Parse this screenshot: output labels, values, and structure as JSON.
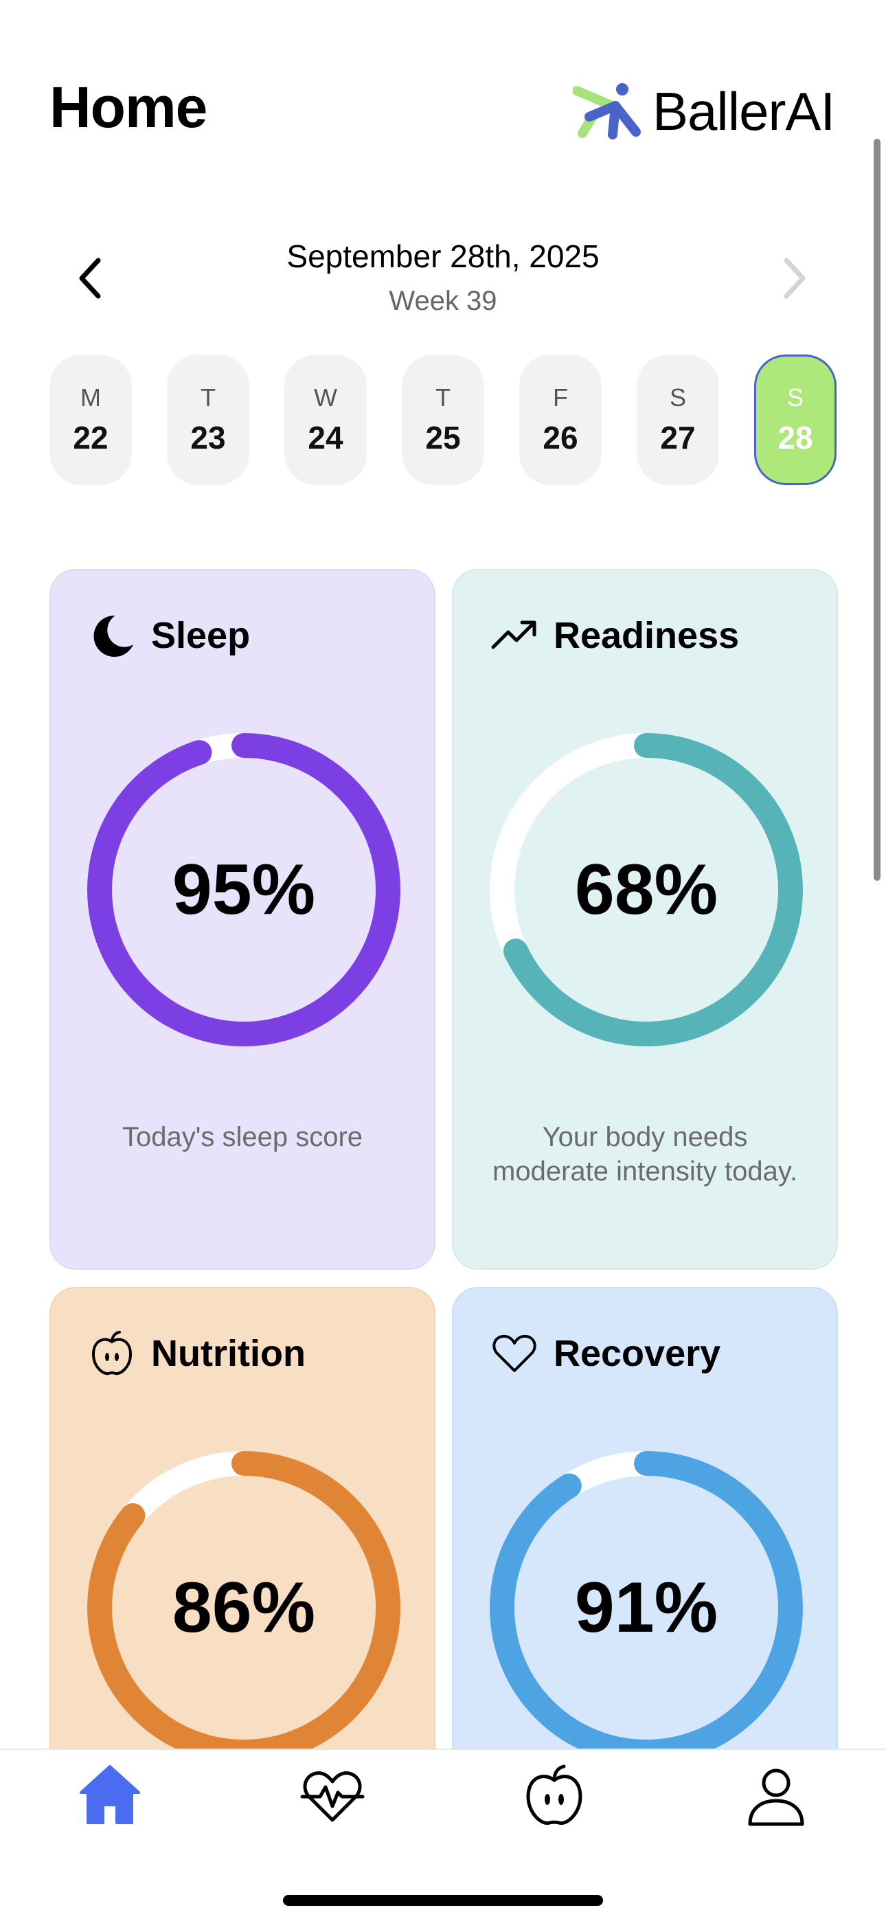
{
  "header": {
    "title": "Home",
    "logo_text": "BallerAI"
  },
  "date_nav": {
    "date": "September 28th, 2025",
    "week": "Week 39"
  },
  "days": [
    {
      "letter": "M",
      "num": "22"
    },
    {
      "letter": "T",
      "num": "23"
    },
    {
      "letter": "W",
      "num": "24"
    },
    {
      "letter": "T",
      "num": "25"
    },
    {
      "letter": "F",
      "num": "26"
    },
    {
      "letter": "S",
      "num": "27"
    },
    {
      "letter": "S",
      "num": "28"
    }
  ],
  "selected_day_index": 6,
  "cards": [
    {
      "title": "Sleep",
      "value": "95%",
      "fraction": 0.95,
      "desc": "Today's sleep score",
      "icon": "moon-icon",
      "ring_color": "#7b3fe4",
      "bg": "#e8e3fa"
    },
    {
      "title": "Readiness",
      "value": "68%",
      "fraction": 0.68,
      "desc": "Your body needs moderate intensity today.",
      "icon": "trending-up-icon",
      "ring_color": "#56b3b8",
      "bg": "#e1f2f3"
    },
    {
      "title": "Nutrition",
      "value": "86%",
      "fraction": 0.86,
      "desc": "",
      "icon": "apple-icon",
      "ring_color": "#e08535",
      "bg": "#f8dfc3"
    },
    {
      "title": "Recovery",
      "value": "91%",
      "fraction": 0.91,
      "desc": "",
      "icon": "heart-icon",
      "ring_color": "#4ea3e3",
      "bg": "#d6e7fb"
    }
  ],
  "tabs": [
    {
      "name": "home-tab",
      "icon": "home-icon",
      "active": true
    },
    {
      "name": "health-tab",
      "icon": "heart-pulse-icon",
      "active": false
    },
    {
      "name": "nutrition-tab",
      "icon": "apple-icon",
      "active": false
    },
    {
      "name": "profile-tab",
      "icon": "person-icon",
      "active": false
    }
  ],
  "colors": {
    "accent": "#4a6cf0",
    "selected_day": "#aee87b",
    "selected_day_border": "#4a63c9",
    "ring_track": "#ffffff"
  }
}
